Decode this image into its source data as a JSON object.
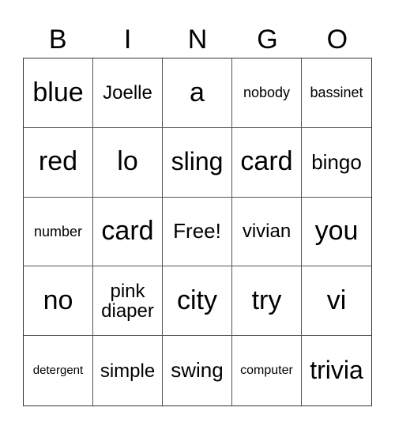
{
  "header": {
    "letters": [
      "B",
      "I",
      "N",
      "G",
      "O"
    ]
  },
  "board": {
    "rows": [
      [
        "blue",
        "Joelle",
        "a",
        "nobody",
        "bassinet"
      ],
      [
        "red",
        "lo",
        "sling",
        "card",
        "bingo"
      ],
      [
        "number",
        "card",
        "Free!",
        "vivian",
        "you"
      ],
      [
        "no",
        "pink diaper",
        "city",
        "try",
        "vi"
      ],
      [
        "detergent",
        "simple",
        "swing",
        "computer",
        "trivia"
      ]
    ]
  }
}
